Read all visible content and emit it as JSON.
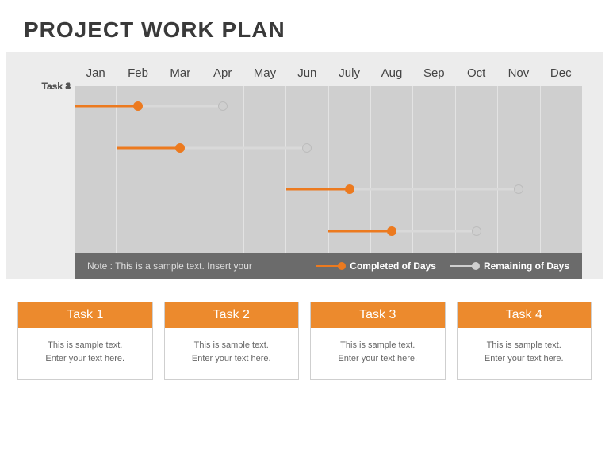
{
  "title": "PROJECT WORK PLAN",
  "months": [
    "Jan",
    "Feb",
    "Mar",
    "Apr",
    "May",
    "Jun",
    "July",
    "Aug",
    "Sep",
    "Oct",
    "Nov",
    "Dec"
  ],
  "tasks": {
    "t1": {
      "label": "Task 1"
    },
    "t2": {
      "label": "Task 2"
    },
    "t3": {
      "label": "Task 3"
    },
    "t4": {
      "label": "Task 4"
    }
  },
  "legend": {
    "note": "Note : This is a sample text. Insert your",
    "completed": "Completed of Days",
    "remaining": "Remaining of Days"
  },
  "cards": {
    "c1": {
      "title": "Task 1",
      "line1": "This is sample text.",
      "line2": "Enter your text here."
    },
    "c2": {
      "title": "Task 2",
      "line1": "This is sample text.",
      "line2": "Enter your text here."
    },
    "c3": {
      "title": "Task 3",
      "line1": "This is sample text.",
      "line2": "Enter your text here."
    },
    "c4": {
      "title": "Task 4",
      "line1": "This is sample text.",
      "line2": "Enter your text here."
    }
  },
  "chart_data": {
    "type": "gantt",
    "title": "Project Work Plan",
    "xlabel": "",
    "ylabel": "",
    "x_categories": [
      "Jan",
      "Feb",
      "Mar",
      "Apr",
      "May",
      "Jun",
      "July",
      "Aug",
      "Sep",
      "Oct",
      "Nov",
      "Dec"
    ],
    "series": [
      {
        "name": "Task 1",
        "start": "Jan",
        "completed_end": "Feb",
        "remaining_end": "Apr"
      },
      {
        "name": "Task 2",
        "start": "Feb",
        "completed_end": "Mar",
        "remaining_end": "Jun"
      },
      {
        "name": "Task 3",
        "start": "Jun",
        "completed_end": "Jul",
        "remaining_end": "Nov"
      },
      {
        "name": "Task 4",
        "start": "Jul",
        "completed_end": "Aug",
        "remaining_end": "Oct"
      }
    ],
    "legend_entries": [
      "Completed of Days",
      "Remaining of Days"
    ],
    "colors": {
      "completed": "#ec7a1f",
      "remaining": "#d9d9d9"
    }
  }
}
